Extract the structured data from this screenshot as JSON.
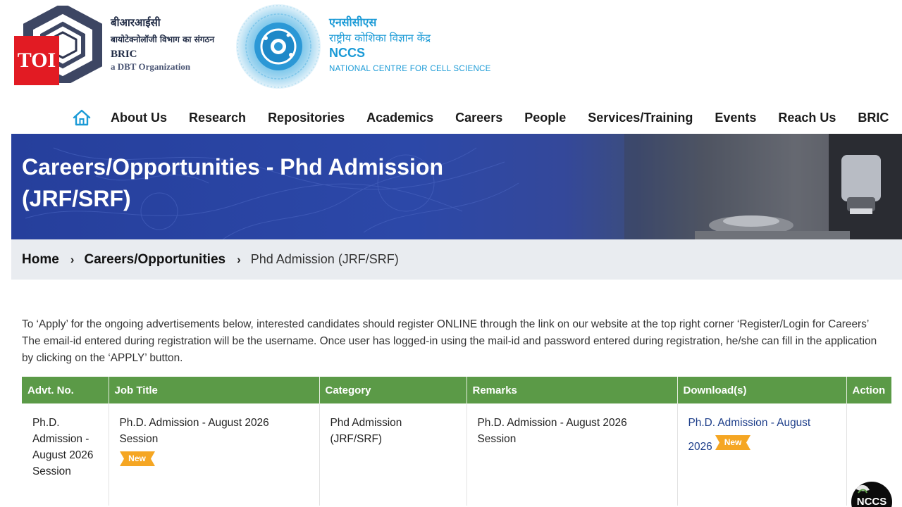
{
  "header": {
    "toi_logo": "TOI",
    "bric": {
      "hindi_name": "बीआरआईसी",
      "hindi_tagline": "बायोटेक्नोलॉजी विभाग का संगठन",
      "name": "BRIC",
      "subtitle": "a DBT Organization"
    },
    "nccs": {
      "hindi_abbr": "एनसीसीएस",
      "hindi_name": "राष्ट्रीय कोशिका विज्ञान केंद्र",
      "abbr": "NCCS",
      "full_name": "NATIONAL CENTRE FOR CELL SCIENCE"
    }
  },
  "nav": {
    "home_icon": "home-icon",
    "items": [
      "About Us",
      "Research",
      "Repositories",
      "Academics",
      "Careers",
      "People",
      "Services/Training",
      "Events",
      "Reach Us",
      "BRIC"
    ]
  },
  "banner": {
    "title_line1": "Careers/Opportunities - Phd Admission",
    "title_line2": "(JRF/SRF)"
  },
  "breadcrumb": {
    "home": "Home",
    "parent": "Careers/Opportunities",
    "current": "Phd Admission (JRF/SRF)",
    "separator": "›"
  },
  "intro_text": "To ‘Apply’ for the ongoing advertisements below, interested candidates should register ONLINE through the link on our website at the top right corner ‘Register/Login for Careers’ The email-id entered during registration will be the username. Once user has logged-in using the mail-id and password entered during registration, he/she can fill in the application by clicking on the ‘APPLY’ button.",
  "table": {
    "headers": [
      "Advt. No.",
      "Job Title",
      "Category",
      "Remarks",
      "Download(s)",
      "Action"
    ],
    "rows": [
      {
        "advt_no": "Ph.D. Admission - August 2026 Session",
        "job_title": "Ph.D. Admission - August 2026 Session",
        "category": "Phd Admission (JRF/SRF)",
        "remarks": "Ph.D. Admission - August 2026 Session",
        "download": "Ph.D. Admission - August 2026",
        "badge": "New",
        "action": ""
      }
    ]
  },
  "widget": {
    "label": "NCCS"
  },
  "colors": {
    "brand_blue": "#1a9ad6",
    "banner_blue": "#2c48a8",
    "table_header_green": "#5b9a47",
    "badge_orange": "#f5a623",
    "toi_red": "#e21b23",
    "link_blue": "#1d3e8a"
  }
}
